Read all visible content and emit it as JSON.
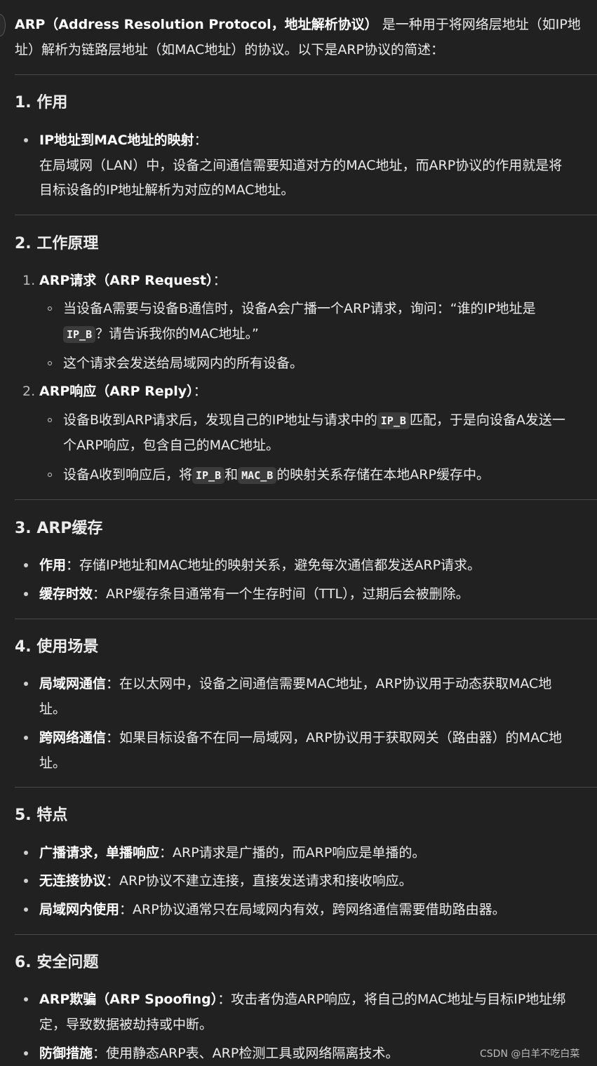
{
  "intro": {
    "bold": "ARP（Address Resolution Protocol，地址解析协议）",
    "line1_rest": "是一种用于将网络层地址（如IP地",
    "line2": "址）解析为链路层地址（如MAC地址）的协议。以下是ARP协议的简述："
  },
  "s1": {
    "title": "1. 作用",
    "item1_label": "IP地址到MAC地址的映射",
    "item1_colon": "：",
    "item1_l1": "在局域网（LAN）中，设备之间通信需要知道对方的MAC地址，而ARP协议的作用就是将",
    "item1_l2": "目标设备的IP地址解析为对应的MAC地址。"
  },
  "s2": {
    "title": "2. 工作原理",
    "n1": "1.",
    "n1_label": "ARP请求（ARP Request）",
    "n1_colon": "：",
    "n1_a_l1": "当设备A需要与设备B通信时，设备A会广播一个ARP请求，询问：“谁的IP地址是",
    "n1_a_code": "IP_B",
    "n1_a_l2": "？请告诉我你的MAC地址。”",
    "n1_b": "这个请求会发送给局域网内的所有设备。",
    "n2": "2.",
    "n2_label": "ARP响应（ARP Reply）",
    "n2_colon": "：",
    "n2_a_pre": "设备B收到ARP请求后，发现自己的IP地址与请求中的",
    "n2_a_code": "IP_B",
    "n2_a_post": "匹配，于是向设备A发送一",
    "n2_a_l2": "个ARP响应，包含自己的MAC地址。",
    "n2_b_pre": "设备A收到响应后，将",
    "n2_b_code1": "IP_B",
    "n2_b_mid": "和",
    "n2_b_code2": "MAC_B",
    "n2_b_post": "的映射关系存储在本地ARP缓存中。"
  },
  "s3": {
    "title": "3. ARP缓存",
    "i1_label": "作用",
    "i1_text": "：存储IP地址和MAC地址的映射关系，避免每次通信都发送ARP请求。",
    "i2_label": "缓存时效",
    "i2_text": "：ARP缓存条目通常有一个生存时间（TTL），过期后会被删除。"
  },
  "s4": {
    "title": "4. 使用场景",
    "i1_label": "局域网通信",
    "i1_text": "：在以太网中，设备之间通信需要MAC地址，ARP协议用于动态获取MAC地",
    "i1_l2": "址。",
    "i2_label": "跨网络通信",
    "i2_text": "：如果目标设备不在同一局域网，ARP协议用于获取网关（路由器）的MAC地",
    "i2_l2": "址。"
  },
  "s5": {
    "title": "5. 特点",
    "i1_label": "广播请求，单播响应",
    "i1_text": "：ARP请求是广播的，而ARP响应是单播的。",
    "i2_label": "无连接协议",
    "i2_text": "：ARP协议不建立连接，直接发送请求和接收响应。",
    "i3_label": "局域网内使用",
    "i3_text": "：ARP协议通常只在局域网内有效，跨网络通信需要借助路由器。"
  },
  "s6": {
    "title": "6. 安全问题",
    "i1_label": "ARP欺骗（ARP Spoofing）",
    "i1_text": "：攻击者伪造ARP响应，将自己的MAC地址与目标IP地址绑",
    "i1_l2": "定，导致数据被劫持或中断。",
    "i2_label": "防御措施",
    "i2_text": "：使用静态ARP表、ARP检测工具或网络隔离技术。"
  },
  "watermark": "CSDN @白羊不吃白菜"
}
